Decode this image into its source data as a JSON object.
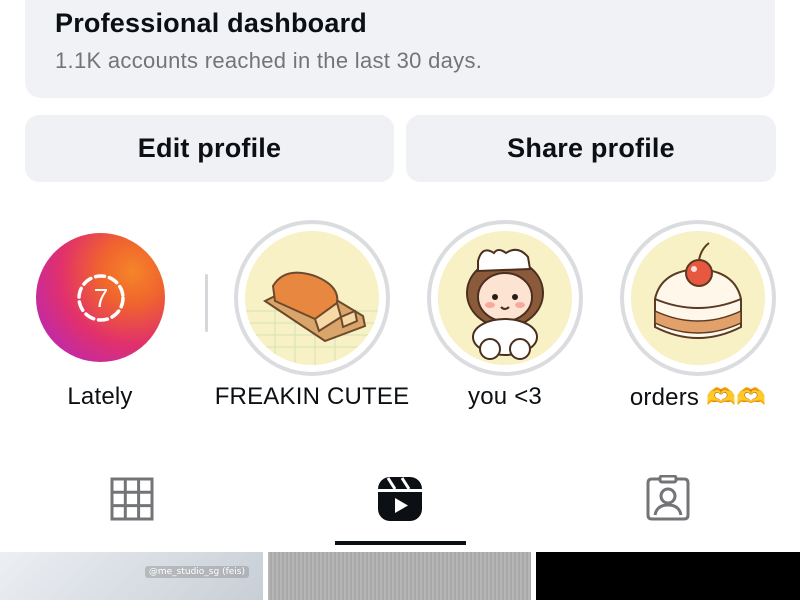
{
  "dashboard": {
    "title": "Professional dashboard",
    "subtitle": "1.1K accounts reached in the last 30 days."
  },
  "buttons": {
    "edit_label": "Edit profile",
    "share_label": "Share profile"
  },
  "highlights": [
    {
      "label": "Lately",
      "icon": "story-archive-icon",
      "badge": "7"
    },
    {
      "label": "FREAKIN CUTEE",
      "icon": "bread-cover-icon"
    },
    {
      "label": "you <3",
      "icon": "girl-cover-icon"
    },
    {
      "label": "orders 🫶🫶",
      "icon": "cake-cover-icon"
    }
  ],
  "tabs": [
    {
      "name": "posts",
      "icon": "grid-icon"
    },
    {
      "name": "reels",
      "icon": "reels-icon",
      "selected": true
    },
    {
      "name": "tagged",
      "icon": "tagged-user-icon"
    }
  ],
  "grid": {
    "thumb1_tag": "@me_studio_sg (feis)"
  },
  "colors": {
    "button_bg": "#eff1f4",
    "text_primary": "#0c1014",
    "text_secondary": "#737477",
    "story_gradient": [
      "#f58529",
      "#e1306c",
      "#8a3ab9"
    ]
  }
}
